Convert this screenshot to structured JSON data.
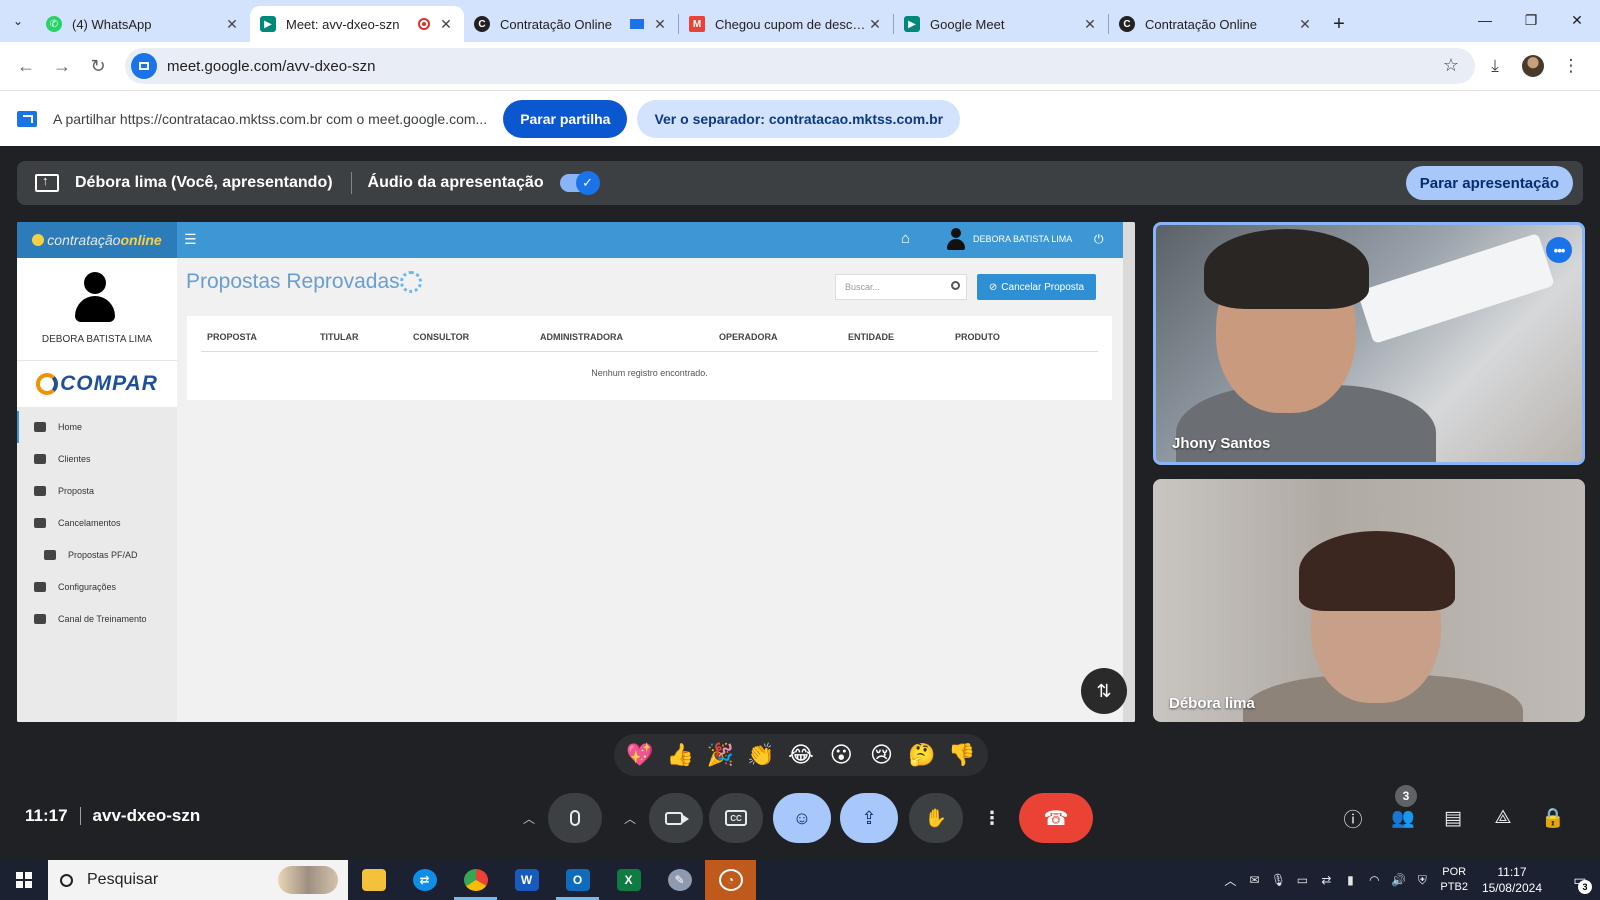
{
  "browser": {
    "tabs": [
      {
        "title": "(4) WhatsApp",
        "favicon": "whatsapp-icon",
        "color": "#25d366"
      },
      {
        "title": "Meet: avv-dxeo-szn",
        "favicon": "meet-icon",
        "color": "#00897b"
      },
      {
        "title": "Contratação Online",
        "favicon": "contratacao-icon",
        "color": "#222222"
      },
      {
        "title": "Chegou cupom de desconto",
        "favicon": "gmail-icon",
        "color": "#ea4335"
      },
      {
        "title": "Google Meet",
        "favicon": "meet-icon",
        "color": "#00897b"
      },
      {
        "title": "Contratação Online",
        "favicon": "contratacao-icon",
        "color": "#222222"
      }
    ],
    "active_tab": 1,
    "url": "meet.google.com/avv-dxeo-szn"
  },
  "share_bar": {
    "text": "A partilhar https://contratacao.mktss.com.br com o meet.google.com...",
    "stop_label": "Parar partilha",
    "view_label": "Ver o separador: contratacao.mktss.com.br"
  },
  "presenting": {
    "name": "Débora lima (Você, apresentando)",
    "audio_label": "Áudio da apresentação",
    "audio_on": true,
    "stop_label": "Parar apresentação"
  },
  "shared_app": {
    "logo_text": "contratação",
    "logo_accent": "online",
    "user_name": "DEBORA BATISTA LIMA",
    "profile_name": "DEBORA BATISTA LIMA",
    "brand": "COMPAR",
    "menu": [
      {
        "label": "Home",
        "icon": "dashboard-icon"
      },
      {
        "label": "Clientes",
        "icon": "users-icon"
      },
      {
        "label": "Proposta",
        "icon": "file-icon"
      },
      {
        "label": "Cancelamentos",
        "icon": "thumbs-down-icon"
      },
      {
        "label": "Propostas PF/AD",
        "icon": "thumbs-down-icon"
      },
      {
        "label": "Configurações",
        "icon": "file-icon"
      },
      {
        "label": "Canal de Treinamento",
        "icon": "video-icon"
      }
    ],
    "page_title": "Propostas Reprovadas",
    "search_placeholder": "Buscar...",
    "cancel_button": "Cancelar Proposta",
    "columns": [
      "PROPOSTA",
      "TITULAR",
      "CONSULTOR",
      "ADMINISTRADORA",
      "OPERADORA",
      "ENTIDADE",
      "PRODUTO"
    ],
    "empty_text": "Nenhum registro encontrado."
  },
  "participants": [
    {
      "name": "Jhony Santos",
      "active_speaker": true
    },
    {
      "name": "Débora lima",
      "active_speaker": false
    }
  ],
  "reactions": [
    "💖",
    "👍",
    "🎉",
    "👏",
    "😂",
    "😮",
    "😢",
    "🤔",
    "👎"
  ],
  "meeting": {
    "time": "11:17",
    "code": "avv-dxeo-szn",
    "participant_count": "3"
  },
  "taskbar": {
    "search_label": "Pesquisar",
    "language": "POR",
    "layout": "PTB2",
    "time": "11:17",
    "date": "15/08/2024",
    "notifications": "3"
  },
  "colors": {
    "accent": "#1a73e8",
    "end_call": "#ea4335",
    "meet_bg": "#202124",
    "shared_header": "#3c97d4"
  }
}
